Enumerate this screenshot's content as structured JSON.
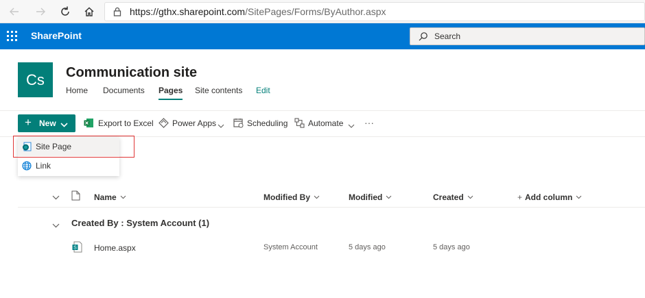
{
  "browser": {
    "url_host": "https://gthx.sharepoint.com",
    "url_path": "/SitePages/Forms/ByAuthor.aspx",
    "icons": [
      "back-icon",
      "forward-icon",
      "refresh-icon",
      "home-icon",
      "lock-icon"
    ]
  },
  "suite": {
    "brand": "SharePoint",
    "search_placeholder": "Search"
  },
  "site": {
    "logo_text": "Cs",
    "title": "Communication site",
    "nav": [
      {
        "label": "Home",
        "active": false
      },
      {
        "label": "Documents",
        "active": false
      },
      {
        "label": "Pages",
        "active": true
      },
      {
        "label": "Site contents",
        "active": false
      },
      {
        "label": "Edit",
        "active": false
      }
    ],
    "accent": "#037f79"
  },
  "commands": {
    "new_label": "New",
    "export_label": "Export to Excel",
    "powerapps_label": "Power Apps",
    "scheduling_label": "Scheduling",
    "automate_label": "Automate",
    "more_label": "···"
  },
  "new_menu": {
    "items": [
      {
        "label": "Site Page",
        "icon": "site-page-icon",
        "highlighted": true
      },
      {
        "label": "Link",
        "icon": "globe-icon",
        "highlighted": false
      }
    ]
  },
  "list": {
    "columns": {
      "name": "Name",
      "modified_by": "Modified By",
      "modified": "Modified",
      "created": "Created",
      "add_column": "Add column"
    },
    "group_label": "Created By : System Account (1)",
    "rows": [
      {
        "name": "Home.aspx",
        "modified_by": "System Account",
        "modified": "5 days ago",
        "created": "5 days ago"
      }
    ]
  }
}
